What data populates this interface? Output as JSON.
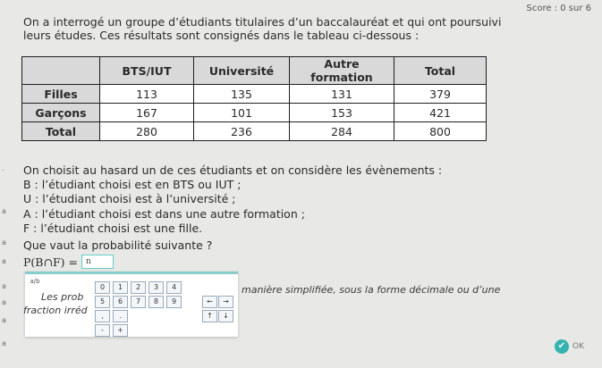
{
  "score": "Score : 0 sur 6",
  "intro": "On a interrogé un groupe d’étudiants titulaires d’un baccalauréat et qui ont poursuivi leurs études. Ces résultats sont consignés dans le tableau ci-dessous :",
  "table": {
    "headers": [
      "",
      "BTS/IUT",
      "Université",
      "Autre formation",
      "Total"
    ],
    "rows": [
      {
        "label": "Filles",
        "values": [
          "113",
          "135",
          "131",
          "379"
        ]
      },
      {
        "label": "Garçons",
        "values": [
          "167",
          "101",
          "153",
          "421"
        ]
      },
      {
        "label": "Total",
        "values": [
          "280",
          "236",
          "284",
          "800"
        ]
      }
    ]
  },
  "events": {
    "intro": "On choisit au hasard un de ces étudiants et on considère les évènements :",
    "b": "B : l’étudiant choisi est en BTS ou IUT ;",
    "u": "U : l’étudiant choisi est à l’université ;",
    "a": "A : l’étudiant choisi est dans une autre formation ;",
    "f": "F : l’étudiant choisi est une fille."
  },
  "question": "Que vaut la probabilité suivante ?",
  "formula": "P(B∩F) =",
  "answer_input": "n",
  "keypad": {
    "fraction": "a/b",
    "keys_row1": [
      "0",
      "1",
      "2",
      "3",
      "4"
    ],
    "keys_row2": [
      "5",
      "6",
      "7",
      "8",
      "9",
      "←",
      "→"
    ],
    "keys_row3": [
      ",",
      ".",
      "↑",
      "↓"
    ],
    "keys_row4": [
      "-",
      "+"
    ]
  },
  "hint_left": "Les prob",
  "hint_right": "manière simplifiée, sous la forme décimale ou d’une",
  "hint_line2": "fraction irréd",
  "ok_label": "OK",
  "colors": {
    "accent": "#35b3b0",
    "header_bg": "#d9d9d9"
  }
}
